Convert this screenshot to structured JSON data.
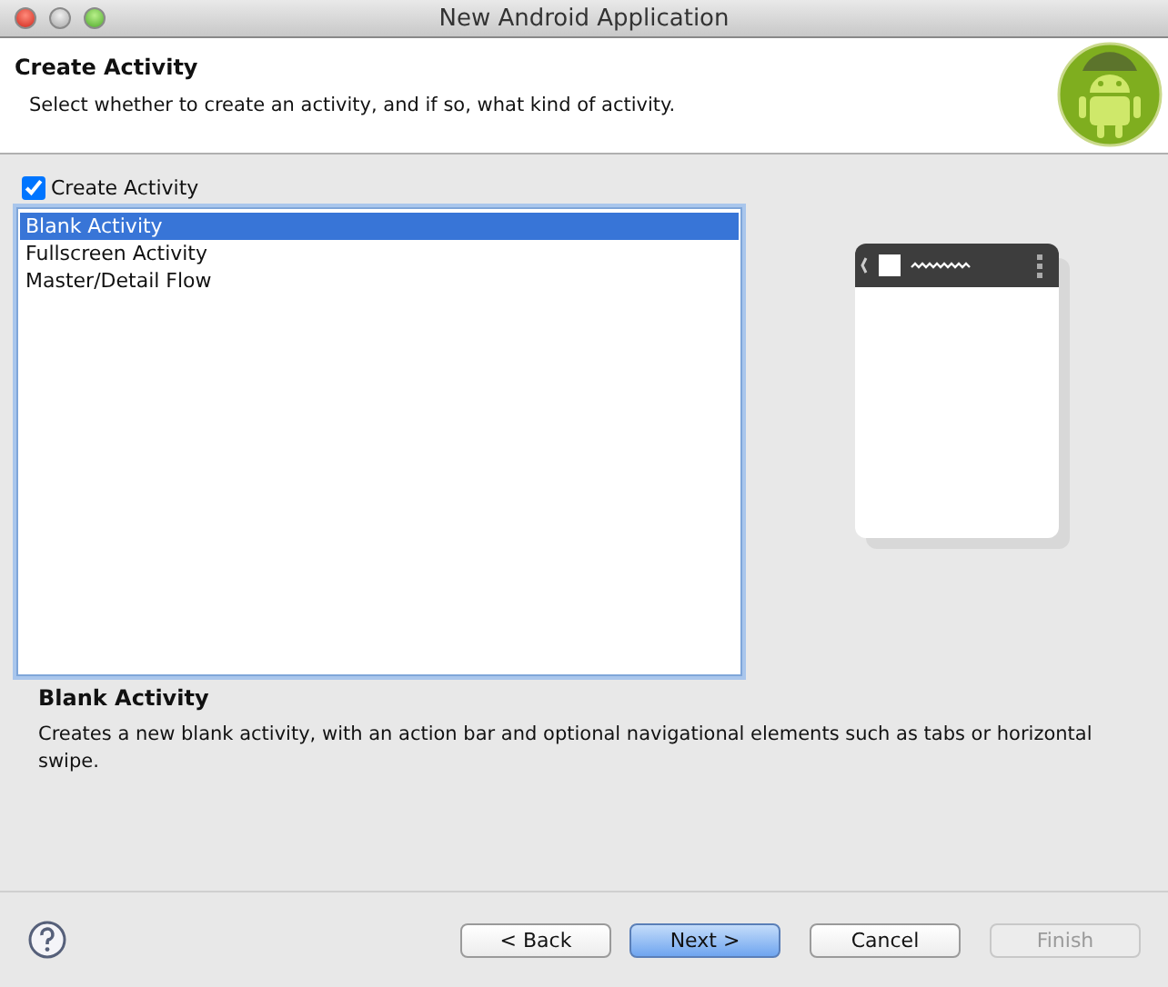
{
  "window": {
    "title": "New Android Application"
  },
  "header": {
    "title": "Create Activity",
    "subtitle": "Select whether to create an activity, and if so, what kind of activity."
  },
  "create_activity": {
    "label": "Create Activity",
    "checked": true
  },
  "activities": [
    {
      "label": "Blank Activity",
      "selected": true
    },
    {
      "label": "Fullscreen Activity",
      "selected": false
    },
    {
      "label": "Master/Detail Flow",
      "selected": false
    }
  ],
  "details": {
    "title": "Blank Activity",
    "text": "Creates a new blank activity, with an action bar and optional navigational elements such as tabs or horizontal swipe."
  },
  "buttons": [
    {
      "label": "< Back",
      "default": false,
      "disabled": false
    },
    {
      "label": "Next >",
      "default": true,
      "disabled": false
    },
    {
      "label": "Cancel",
      "default": false,
      "disabled": false
    },
    {
      "label": "Finish",
      "default": false,
      "disabled": true
    }
  ]
}
